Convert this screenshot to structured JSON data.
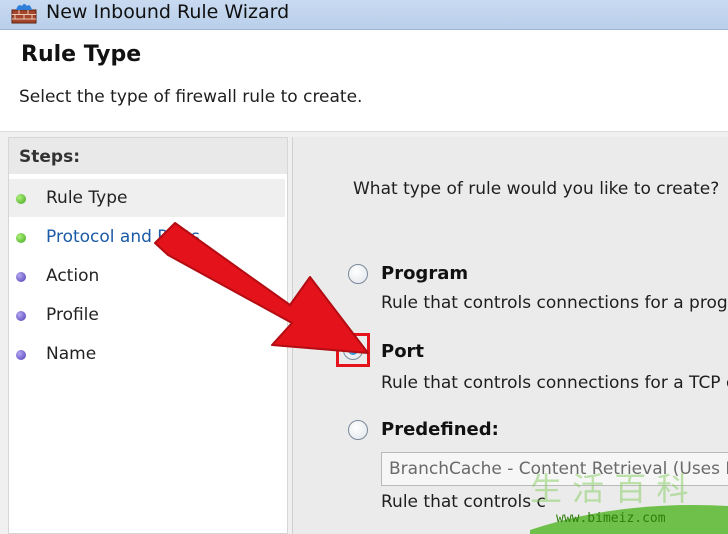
{
  "window": {
    "title": "New Inbound Rule Wizard",
    "icon": "firewall-icon"
  },
  "header": {
    "title": "Rule Type",
    "subtitle": "Select the type of firewall rule to create."
  },
  "steps": {
    "heading": "Steps:",
    "items": [
      {
        "label": "Rule Type",
        "status": "completed",
        "dot_color": "#3ea51f"
      },
      {
        "label": "Protocol and Ports",
        "status": "completed",
        "dot_color": "#3ea51f"
      },
      {
        "label": "Action",
        "status": "pending",
        "dot_color": "#4b39b8"
      },
      {
        "label": "Profile",
        "status": "pending",
        "dot_color": "#4b39b8"
      },
      {
        "label": "Name",
        "status": "pending",
        "dot_color": "#4b39b8"
      }
    ]
  },
  "main": {
    "question": "What type of rule would you like to create?",
    "options": [
      {
        "label": "Program",
        "description": "Rule that controls connections for a program",
        "selected": false
      },
      {
        "label": "Port",
        "description": "Rule that controls connections for a TCP or",
        "selected": true
      },
      {
        "label": "Predefined:",
        "description": "Rule that controls c",
        "selected": false
      }
    ],
    "predefined_value": "BranchCache - Content Retrieval (Uses HT"
  },
  "overlay": {
    "arrow_color": "#e3121b",
    "highlight_color": "#e3121b"
  },
  "watermark": {
    "url": "www.bimeiz.com"
  }
}
